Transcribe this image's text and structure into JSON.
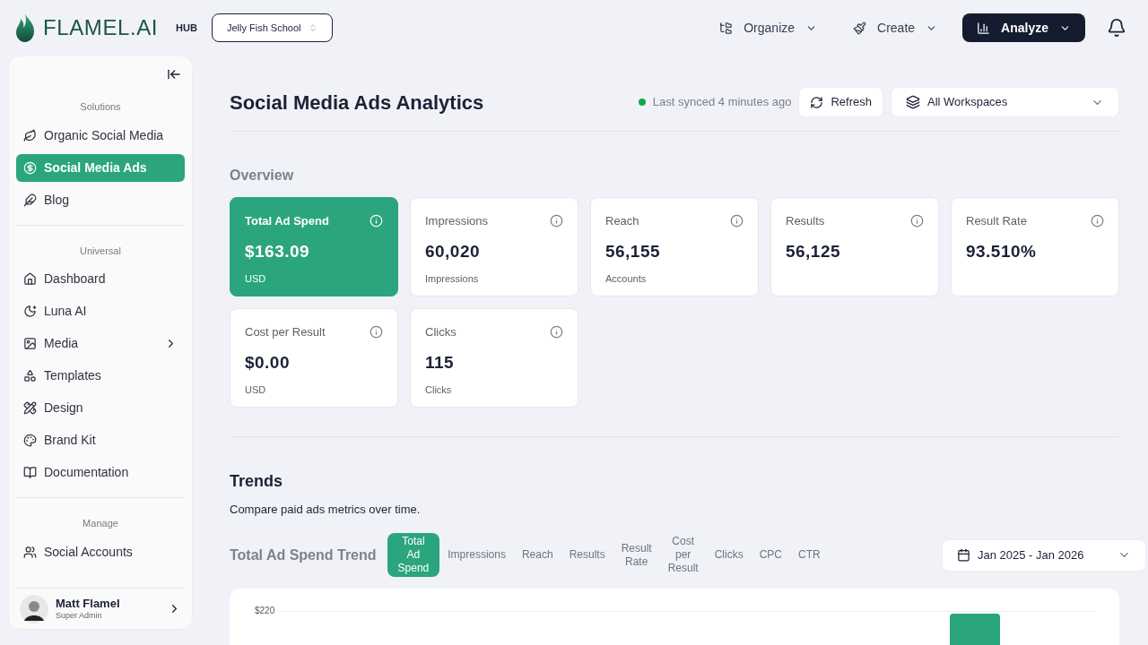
{
  "brand": {
    "name": "FLAMEL.AI",
    "badge": "HUB"
  },
  "workspace_switcher": "Jelly Fish School",
  "nav": [
    {
      "label": "Organize",
      "selected": false
    },
    {
      "label": "Create",
      "selected": false
    },
    {
      "label": "Analyze",
      "selected": true
    }
  ],
  "sidebar": {
    "sections": [
      {
        "title": "Solutions",
        "items": [
          {
            "label": "Organic Social Media",
            "selected": false
          },
          {
            "label": "Social Media Ads",
            "selected": true
          },
          {
            "label": "Blog",
            "selected": false
          }
        ]
      },
      {
        "title": "Universal",
        "items": [
          {
            "label": "Dashboard",
            "selected": false
          },
          {
            "label": "Luna AI",
            "selected": false
          },
          {
            "label": "Media",
            "selected": false,
            "has_submenu": true
          },
          {
            "label": "Templates",
            "selected": false
          },
          {
            "label": "Design",
            "selected": false
          },
          {
            "label": "Brand Kit",
            "selected": false
          },
          {
            "label": "Documentation",
            "selected": false
          }
        ]
      },
      {
        "title": "Manage",
        "items": [
          {
            "label": "Social Accounts",
            "selected": false
          }
        ]
      }
    ],
    "user": {
      "name": "Matt Flamel",
      "role": "Super Admin"
    }
  },
  "page": {
    "title": "Social Media Ads Analytics",
    "sync_status": "Last synced 4 minutes ago",
    "refresh": "Refresh",
    "workspace_filter": "All Workspaces"
  },
  "overview": {
    "title": "Overview",
    "cards": [
      {
        "label": "Total Ad Spend",
        "value": "$163.09",
        "unit": "USD",
        "selected": true
      },
      {
        "label": "Impressions",
        "value": "60,020",
        "unit": "Impressions",
        "selected": false
      },
      {
        "label": "Reach",
        "value": "56,155",
        "unit": "Accounts",
        "selected": false
      },
      {
        "label": "Results",
        "value": "56,125",
        "selected": false
      },
      {
        "label": "Result Rate",
        "value": "93.510%",
        "selected": false
      },
      {
        "label": "Cost per Result",
        "value": "$0.00",
        "unit": "USD",
        "selected": false
      },
      {
        "label": "Clicks",
        "value": "115",
        "unit": "Clicks",
        "selected": false
      }
    ]
  },
  "trends": {
    "title": "Trends",
    "subtitle": "Compare paid ads metrics over time.",
    "chart_title": "Total Ad Spend Trend",
    "tabs": [
      {
        "label": "Total Ad Spend",
        "selected": true
      },
      {
        "label": "Impressions",
        "selected": false
      },
      {
        "label": "Reach",
        "selected": false
      },
      {
        "label": "Results",
        "selected": false
      },
      {
        "label": "Result Rate",
        "selected": false
      },
      {
        "label": "Cost per Result",
        "selected": false
      },
      {
        "label": "Clicks",
        "selected": false
      },
      {
        "label": "CPC",
        "selected": false
      },
      {
        "label": "CTR",
        "selected": false
      }
    ],
    "date_range": "Jan 2025 - Jan 2026",
    "y_tick": "$220"
  }
}
